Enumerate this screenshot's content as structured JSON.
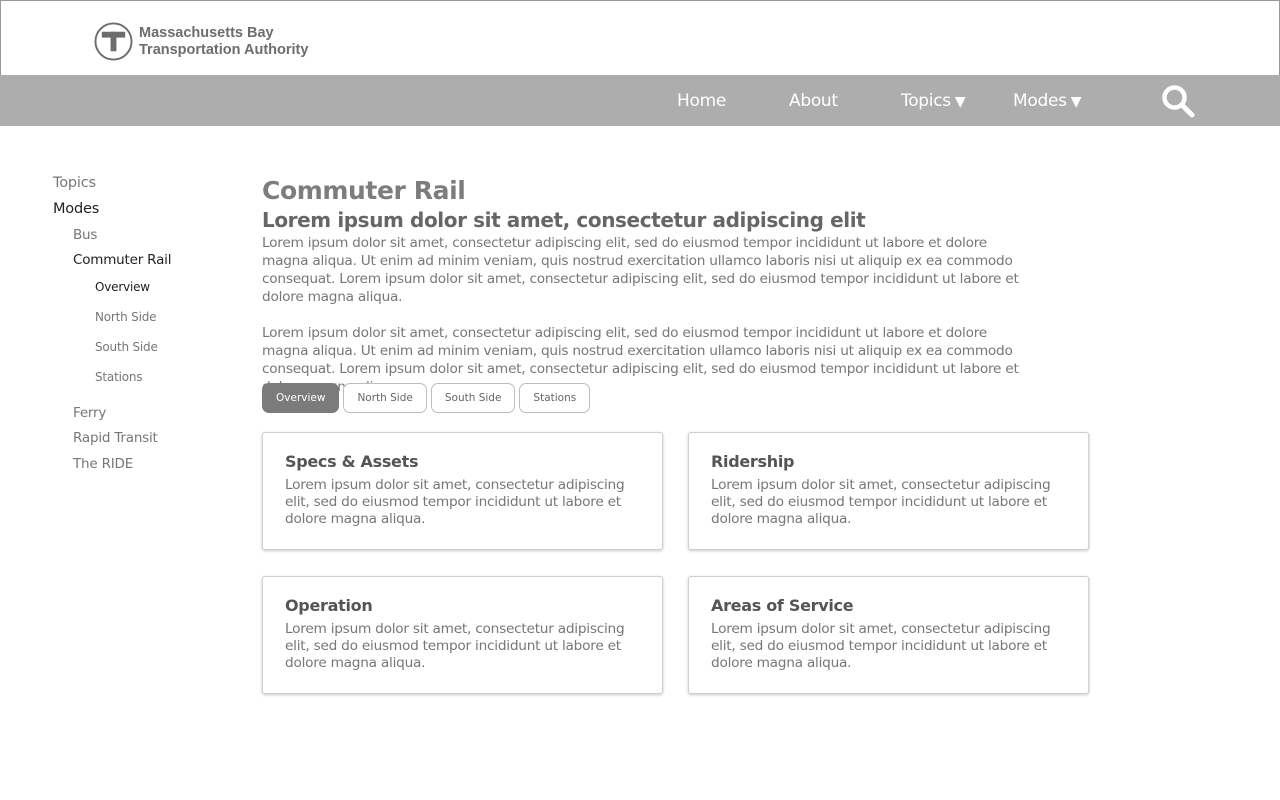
{
  "header": {
    "logo_line1": "Massachusetts Bay",
    "logo_line2": "Transportation Authority",
    "logo_icon": "t-logo-icon"
  },
  "nav": {
    "items": [
      {
        "label": "Home",
        "caret": ""
      },
      {
        "label": "About",
        "caret": ""
      },
      {
        "label": "Topics",
        "caret": "▼"
      },
      {
        "label": "Modes",
        "caret": "▼"
      }
    ],
    "search_icon": "search-icon"
  },
  "sidebar": {
    "items": [
      {
        "label": "Topics",
        "level": 1,
        "active": false
      },
      {
        "label": "Modes",
        "level": 1,
        "active": true
      },
      {
        "label": "Bus",
        "level": 2,
        "active": false
      },
      {
        "label": "Commuter Rail",
        "level": 2,
        "active": true
      },
      {
        "label": "Overview",
        "level": 3,
        "active": true
      },
      {
        "label": "North Side",
        "level": 3,
        "active": false
      },
      {
        "label": "South Side",
        "level": 3,
        "active": false
      },
      {
        "label": "Stations",
        "level": 3,
        "active": false
      },
      {
        "label": "Ferry",
        "level": 2,
        "active": false
      },
      {
        "label": "Rapid Transit",
        "level": 2,
        "active": false
      },
      {
        "label": "The RIDE",
        "level": 2,
        "active": false
      }
    ]
  },
  "main": {
    "title": "Commuter Rail",
    "subtitle": "Lorem ipsum dolor sit amet, consectetur adipiscing elit",
    "paragraphs": [
      "Lorem ipsum dolor sit amet, consectetur adipiscing elit, sed do eiusmod tempor incididunt ut labore et dolore magna aliqua. Ut enim ad minim veniam, quis nostrud exercitation ullamco laboris nisi ut aliquip ex ea commodo consequat. Lorem ipsum dolor sit amet, consectetur adipiscing elit, sed do eiusmod tempor incididunt ut labore et dolore magna aliqua.",
      "Lorem ipsum dolor sit amet, consectetur adipiscing elit, sed do eiusmod tempor incididunt ut labore et dolore magna aliqua. Ut enim ad minim veniam, quis nostrud exercitation ullamco laboris nisi ut aliquip ex ea commodo consequat. Lorem ipsum dolor sit amet, consectetur adipiscing elit, sed do eiusmod tempor incididunt ut labore et dolore magna aliqua."
    ],
    "tabs": [
      {
        "label": "Overview",
        "active": true
      },
      {
        "label": "North Side",
        "active": false
      },
      {
        "label": "South Side",
        "active": false
      },
      {
        "label": "Stations",
        "active": false
      }
    ],
    "cards": [
      {
        "title": "Specs & Assets",
        "body": "Lorem ipsum dolor sit amet, consectetur adipiscing elit, sed do eiusmod tempor incididunt ut labore et dolore magna aliqua."
      },
      {
        "title": "Ridership",
        "body": "Lorem ipsum dolor sit amet, consectetur adipiscing elit, sed do eiusmod tempor incididunt ut labore et dolore magna aliqua."
      },
      {
        "title": "Operation",
        "body": "Lorem ipsum dolor sit amet, consectetur adipiscing elit, sed do eiusmod tempor incididunt ut labore et dolore magna aliqua."
      },
      {
        "title": "Areas of Service",
        "body": "Lorem ipsum dolor sit amet, consectetur adipiscing elit, sed do eiusmod tempor incididunt ut labore et dolore magna aliqua."
      }
    ]
  },
  "colors": {
    "nav_bg": "#adadad",
    "active_tab_bg": "#7b7b7b",
    "logo_gray": "#6d6d6d"
  }
}
